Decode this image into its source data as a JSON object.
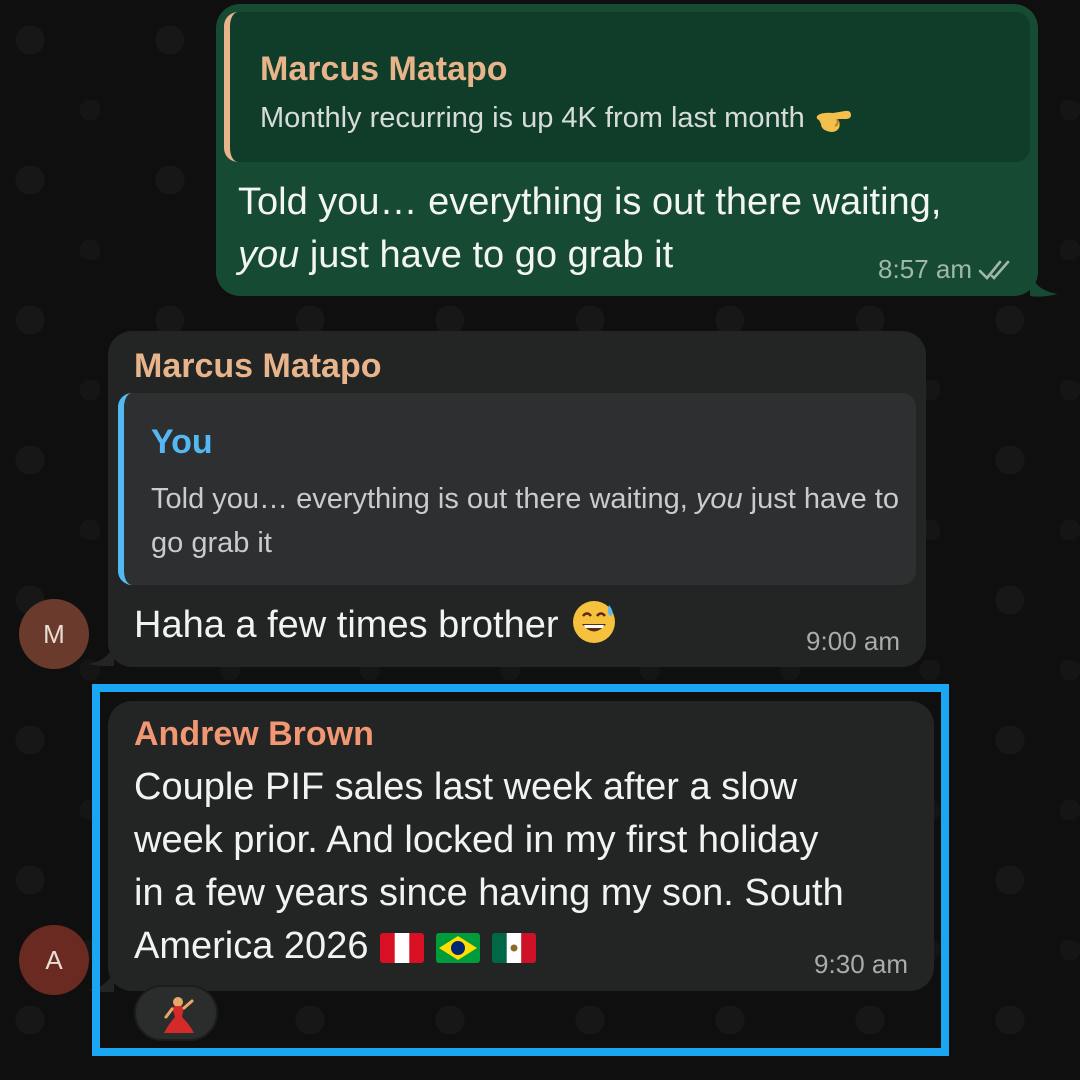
{
  "messages": {
    "outgoing": {
      "quote": {
        "author": "Marcus Matapo",
        "text": "Monthly recurring is up 4K from last month",
        "emoji_icon": "pointing-hand-emoji"
      },
      "text_line1": "Told you… everything is out there waiting,",
      "text_line2_italic": "you",
      "text_line2_rest": " just have to go grab it",
      "time": "8:57 am",
      "status_icon": "double-check-icon"
    },
    "reply": {
      "sender": "Marcus Matapo",
      "quote": {
        "author": "You",
        "text_part1": "Told you… everything is out there waiting, ",
        "text_italic": "you",
        "text_part2": " just have to go grab it"
      },
      "text": "Haha a few times brother",
      "emoji_icon": "grinning-sweat-emoji",
      "time": "9:00 am",
      "avatar_initial": "M"
    },
    "andrew": {
      "sender": "Andrew Brown",
      "line1": "Couple PIF sales last week after a slow",
      "line2": "week prior. And locked in my first holiday",
      "line3": "in a few years since having my son. South",
      "line4": "America 2026",
      "flags": [
        "peru-flag-emoji",
        "brazil-flag-emoji",
        "mexico-flag-emoji"
      ],
      "time": "9:30 am",
      "avatar_initial": "A",
      "reaction_icon": "dancer-emoji"
    }
  },
  "colors": {
    "outgoing_bubble": "#174a33",
    "incoming_bubble": "#232424",
    "highlight": "#1aa6f0",
    "name_marcus": "#e7b48c",
    "name_you": "#54b9f2",
    "name_andrew": "#f29774"
  }
}
